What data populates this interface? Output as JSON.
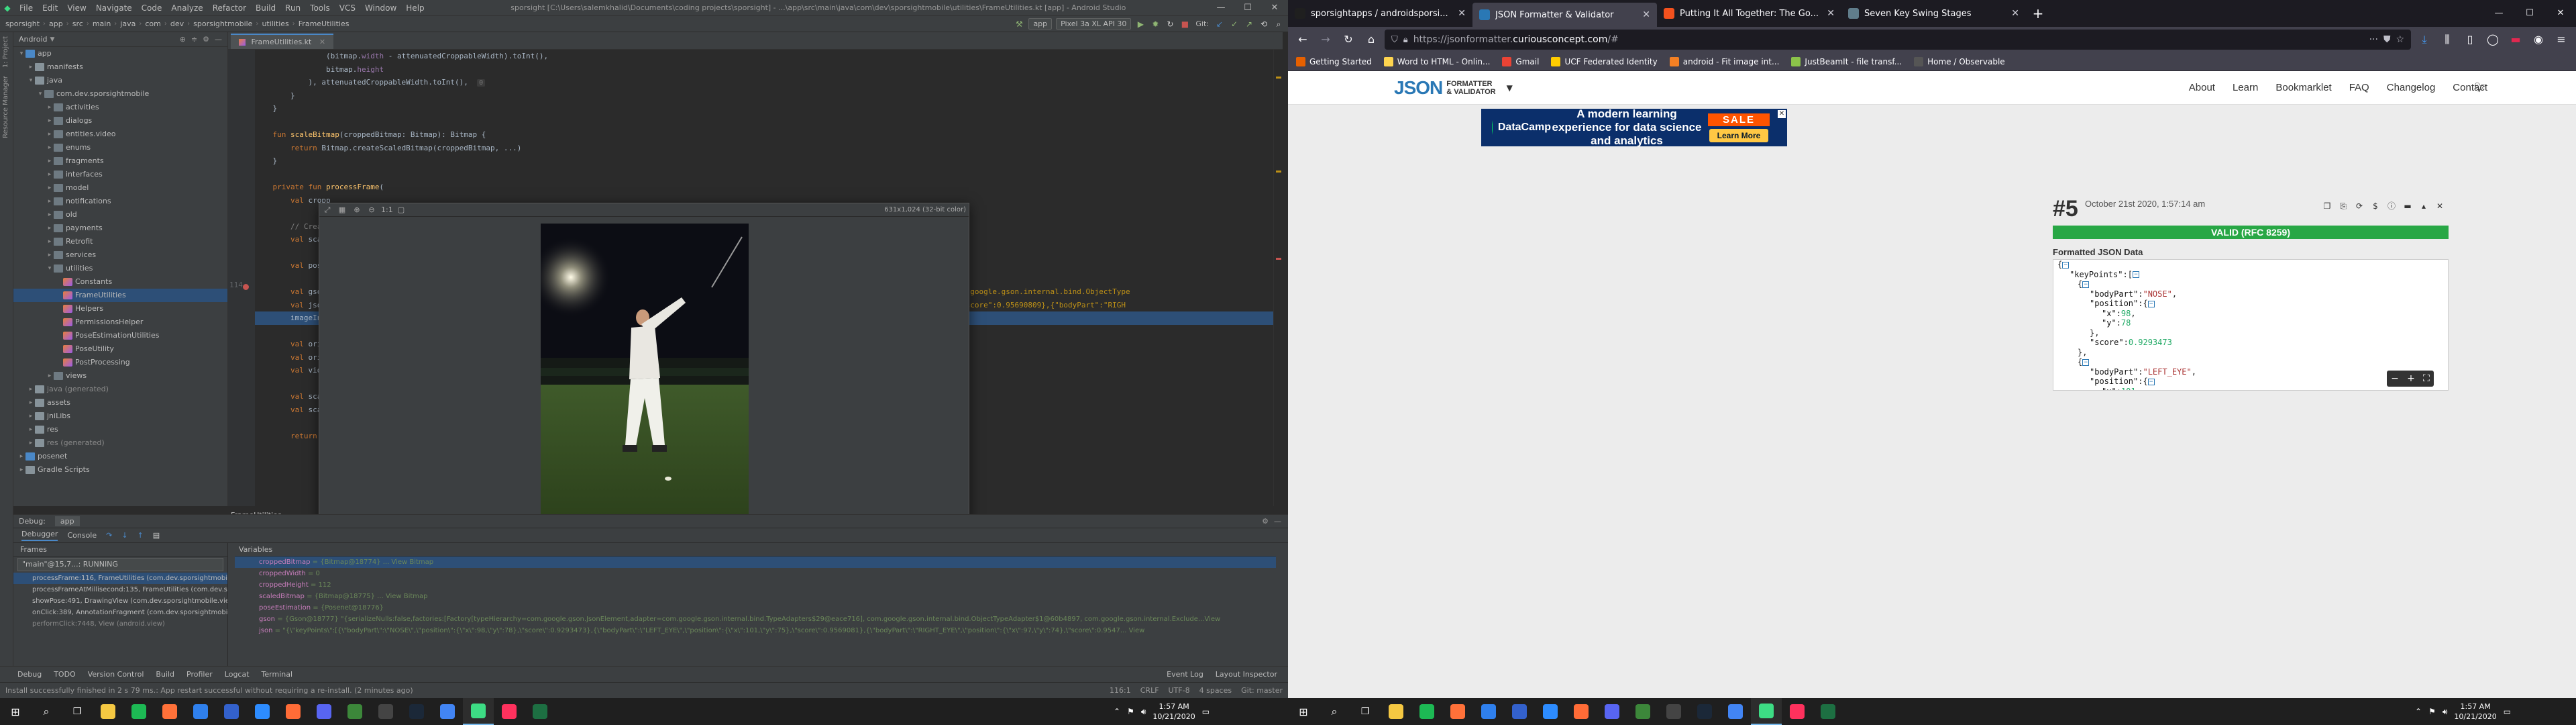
{
  "android_studio": {
    "menu": [
      "File",
      "Edit",
      "View",
      "Navigate",
      "Code",
      "Analyze",
      "Refactor",
      "Build",
      "Run",
      "Tools",
      "VCS",
      "Window",
      "Help"
    ],
    "window_title": "sporsight [C:\\Users\\salemkhalid\\Documents\\coding projects\\sporsight] - ...\\app\\src\\main\\java\\com\\dev\\sporsightmobile\\utilities\\FrameUtilities.kt [app] - Android Studio",
    "breadcrumbs": [
      "sporsight",
      "app",
      "src",
      "main",
      "java",
      "com",
      "dev",
      "sporsightmobile",
      "utilities",
      "FrameUtilities"
    ],
    "run_config": "app",
    "device": "Pixel 3a XL API 30",
    "git_label": "Git:",
    "project_view": "Android",
    "tree": [
      {
        "label": "app",
        "depth": 0,
        "icon": "mod",
        "open": true
      },
      {
        "label": "manifests",
        "depth": 1,
        "icon": "folder",
        "open": false
      },
      {
        "label": "java",
        "depth": 1,
        "icon": "folder",
        "open": true
      },
      {
        "label": "com.dev.sporsightmobile",
        "depth": 2,
        "icon": "pkg",
        "open": true
      },
      {
        "label": "activities",
        "depth": 3,
        "icon": "pkg",
        "open": false
      },
      {
        "label": "dialogs",
        "depth": 3,
        "icon": "pkg",
        "open": false
      },
      {
        "label": "entities.video",
        "depth": 3,
        "icon": "pkg",
        "open": false
      },
      {
        "label": "enums",
        "depth": 3,
        "icon": "pkg",
        "open": false
      },
      {
        "label": "fragments",
        "depth": 3,
        "icon": "pkg",
        "open": false
      },
      {
        "label": "interfaces",
        "depth": 3,
        "icon": "pkg",
        "open": false
      },
      {
        "label": "model",
        "depth": 3,
        "icon": "pkg",
        "open": false
      },
      {
        "label": "notifications",
        "depth": 3,
        "icon": "pkg",
        "open": false
      },
      {
        "label": "old",
        "depth": 3,
        "icon": "pkg",
        "open": false
      },
      {
        "label": "payments",
        "depth": 3,
        "icon": "pkg",
        "open": false
      },
      {
        "label": "Retrofit",
        "depth": 3,
        "icon": "pkg",
        "open": false
      },
      {
        "label": "services",
        "depth": 3,
        "icon": "pkg",
        "open": false
      },
      {
        "label": "utilities",
        "depth": 3,
        "icon": "pkg",
        "open": true
      },
      {
        "label": "Constants",
        "depth": 4,
        "icon": "kt",
        "open": null
      },
      {
        "label": "FrameUtilities",
        "depth": 4,
        "icon": "kt",
        "open": null,
        "selected": true
      },
      {
        "label": "Helpers",
        "depth": 4,
        "icon": "kt",
        "open": null
      },
      {
        "label": "PermissionsHelper",
        "depth": 4,
        "icon": "kt",
        "open": null
      },
      {
        "label": "PoseEstimationUtilities",
        "depth": 4,
        "icon": "kt",
        "open": null
      },
      {
        "label": "PoseUtility",
        "depth": 4,
        "icon": "kt",
        "open": null
      },
      {
        "label": "PostProcessing",
        "depth": 4,
        "icon": "kt",
        "open": null
      },
      {
        "label": "views",
        "depth": 3,
        "icon": "pkg",
        "open": false
      },
      {
        "label": "java (generated)",
        "depth": 1,
        "icon": "folder",
        "open": false,
        "excl": true
      },
      {
        "label": "assets",
        "depth": 1,
        "icon": "folder",
        "open": false
      },
      {
        "label": "jniLibs",
        "depth": 1,
        "icon": "folder",
        "open": false
      },
      {
        "label": "res",
        "depth": 1,
        "icon": "folder",
        "open": false
      },
      {
        "label": "res (generated)",
        "depth": 1,
        "icon": "folder",
        "open": false,
        "excl": true
      },
      {
        "label": "posenet",
        "depth": 0,
        "icon": "mod",
        "open": false
      },
      {
        "label": "Gradle Scripts",
        "depth": 0,
        "icon": "folder",
        "open": false
      }
    ],
    "editor_tab": "FrameUtilities.kt",
    "editor_footer_tab": "FrameUtilities",
    "highlighted_line_number": "114",
    "bitmap_viewer": {
      "info": "631x1,024 (32-bit color)"
    },
    "debug": {
      "title": "Debug:",
      "config": "app",
      "tabs": [
        "Debugger",
        "Console"
      ],
      "frames_header": "Frames",
      "variables_header": "Variables",
      "thread": "\"main\"@15,7...: RUNNING",
      "frames": [
        {
          "text": "processFrame:116, FrameUtilities (com.dev.sporsightmobile.utilities)",
          "selected": true
        },
        {
          "text": "processFrameAtMillisecond:135, FrameUtilities (com.dev.sporsightmobile.utilities)"
        },
        {
          "text": "showPose:491, DrawingView (com.dev.sporsightmobile.views)"
        },
        {
          "text": "onClick:389, AnnotationFragment (com.dev.sporsightmobile.fragments)"
        },
        {
          "text": "performClick:7448, View (android.view)",
          "lib": true
        }
      ],
      "variables": [
        {
          "name": "croppedBitmap",
          "value": "= {Bitmap@18774} ... View Bitmap",
          "selected": true
        },
        {
          "name": "croppedWidth",
          "value": "= 0"
        },
        {
          "name": "croppedHeight",
          "value": "= 112"
        },
        {
          "name": "scaledBitmap",
          "value": "= {Bitmap@18775} ... View Bitmap"
        },
        {
          "name": "poseEstimation",
          "value": "= {Posenet@18776}"
        },
        {
          "name": "gson",
          "value": "= {Gson@18777} \"{serializeNulls:false,factories:[Factory[typeHierarchy=com.google.gson.JsonElement,adapter=com.google.gson.internal.bind.TypeAdapters$29@eace716], com.google.gson.internal.bind.ObjectTypeAdapter$1@60b4897, com.google.gson.internal.Exclude...View"
        },
        {
          "name": "json",
          "value": "= \"{\\\"keyPoints\\\":[{\\\"bodyPart\\\":\\\"NOSE\\\",\\\"position\\\":{\\\"x\\\":98,\\\"y\\\":78},\\\"score\\\":0.9293473},{\\\"bodyPart\\\":\\\"LEFT_EYE\\\",\\\"position\\\":{\\\"x\\\":101,\\\"y\\\":75},\\\"score\\\":0.9569081},{\\\"bodyPart\\\":\\\"RIGHT_EYE\\\",\\\"position\\\":{\\\"x\\\":97,\\\"y\\\":74},\\\"score\\\":0.9547... View"
        }
      ]
    },
    "bottom_tabs": [
      "Debug",
      "TODO",
      "Version Control",
      "Build",
      "Profiler",
      "Logcat",
      "Terminal"
    ],
    "bottom_right": [
      "Event Log",
      "Layout Inspector"
    ],
    "status_message": "Install successfully finished in 2 s 79 ms.: App restart successful without requiring a re-install. (2 minutes ago)",
    "status_right": [
      "116:1",
      "CRLF",
      "UTF-8",
      "4 spaces",
      "Git: master"
    ]
  },
  "firefox": {
    "tabs": [
      {
        "title": "sporsightapps / androidsporsi...",
        "color": "#1f1f1f",
        "active": false
      },
      {
        "title": "JSON Formatter & Validator",
        "color": "#2a78b5",
        "active": true
      },
      {
        "title": "Putting It All Together: The Go...",
        "color": "#f4511e",
        "active": false
      },
      {
        "title": "Seven Key Swing Stages",
        "color": "#607d8b",
        "active": false
      }
    ],
    "url_dim": "https://jsonformatter.",
    "url_main": "curiousconcept.com",
    "url_tail": "/#",
    "bookmarks": [
      {
        "label": "Getting Started",
        "color": "#e66000"
      },
      {
        "label": "Word to HTML - Onlin...",
        "color": "#ffd54f"
      },
      {
        "label": "Gmail",
        "color": "#ea4335"
      },
      {
        "label": "UCF Federated Identity",
        "color": "#ffcc00"
      },
      {
        "label": "android - Fit image int...",
        "color": "#f48024"
      },
      {
        "label": "JustBeamIt - file transf...",
        "color": "#8bc34a"
      },
      {
        "label": "Home / Observable",
        "color": "#555"
      }
    ]
  },
  "site": {
    "logo_main": "JSON",
    "logo_sub1": "FORMATTER",
    "logo_sub2": "& VALIDATOR",
    "nav": [
      "About",
      "Learn",
      "Bookmarklet",
      "FAQ",
      "Changelog",
      "Contact"
    ],
    "ad": {
      "brand": "DataCamp",
      "text": "A modern learning experience for data science and analytics",
      "sale": "SALE",
      "cta": "Learn More"
    },
    "result_number": "#5",
    "result_date": "October 21st 2020, 1:57:14 am",
    "valid": "VALID (RFC 8259)",
    "formatted_title": "Formatted JSON Data"
  },
  "taskbar": {
    "apps": [
      {
        "name": "file-explorer",
        "color": "#f5c842"
      },
      {
        "name": "spotify",
        "color": "#1db954"
      },
      {
        "name": "firefox",
        "color": "#ff7139"
      },
      {
        "name": "vscode",
        "color": "#2f80ed"
      },
      {
        "name": "simplenote",
        "color": "#3361cc"
      },
      {
        "name": "zoom",
        "color": "#2d8cff"
      },
      {
        "name": "postman",
        "color": "#ff6c37"
      },
      {
        "name": "discord",
        "color": "#5865f2"
      },
      {
        "name": "node",
        "color": "#3c873a"
      },
      {
        "name": "terminal",
        "color": "#444"
      },
      {
        "name": "steam",
        "color": "#1b2838"
      },
      {
        "name": "chrome",
        "color": "#4285f4"
      },
      {
        "name": "android-studio",
        "color": "#3ddc84",
        "active": true
      },
      {
        "name": "intellij",
        "color": "#fe315d"
      },
      {
        "name": "excel",
        "color": "#1d6f42"
      }
    ],
    "time": "1:57 AM",
    "date": "10/21/2020"
  }
}
